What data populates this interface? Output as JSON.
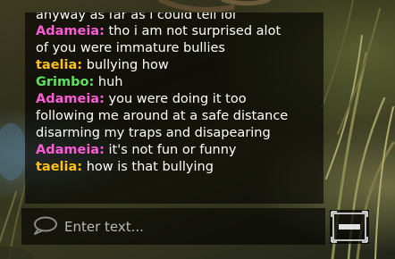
{
  "chat": {
    "partial_line": "anyway as far as i could tell lol",
    "messages": [
      {
        "name": "Adameia:",
        "name_color": "#ff5cd6",
        "lines": [
          "tho i am not surprised alot",
          "of you were immature bullies"
        ]
      },
      {
        "name": "taelia:",
        "name_color": "#ffc21a",
        "lines": [
          "bullying how"
        ]
      },
      {
        "name": "Grimbo:",
        "name_color": "#5fe05f",
        "lines": [
          "huh"
        ]
      },
      {
        "name": "Adameia:",
        "name_color": "#ff5cd6",
        "lines": [
          "you were doing it too",
          "following me around at a safe distance",
          "disarming my traps and disapearing"
        ]
      },
      {
        "name": "Adameia:",
        "name_color": "#ff5cd6",
        "lines": [
          "it's not fun or funny"
        ]
      },
      {
        "name": "taelia:",
        "name_color": "#ffc21a",
        "lines": [
          "how is that bullying"
        ]
      }
    ]
  },
  "scrollbar": {
    "thumb_color": "#e01010",
    "scroll_position": 0.95
  },
  "input": {
    "placeholder": "Enter text...",
    "value": "",
    "icon": "speech-bubble-icon"
  },
  "toggle_button": {
    "icon": "keyboard-icon"
  }
}
